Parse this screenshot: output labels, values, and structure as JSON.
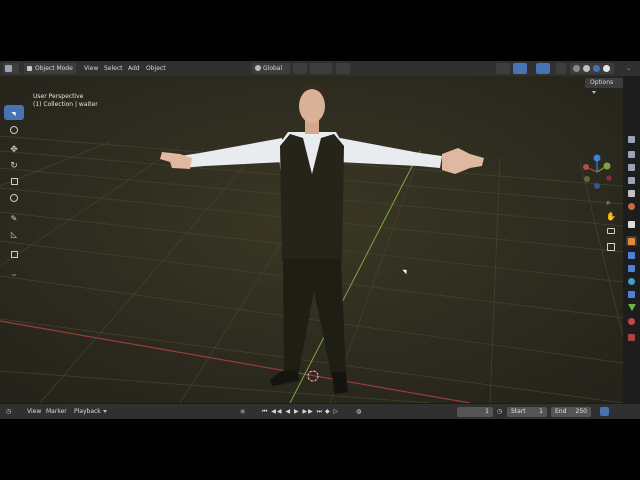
{
  "header": {
    "mode": "Object Mode",
    "menus": [
      "View",
      "Select",
      "Add",
      "Object"
    ],
    "orientation": "Global",
    "options_label": "Options"
  },
  "viewport": {
    "perspective_label": "User Perspective",
    "collection_label": "(1) Collection | waiter"
  },
  "timeline": {
    "menus": [
      "View",
      "Marker",
      "Playback"
    ],
    "current_frame": "1",
    "start_label": "Start",
    "start_value": "1",
    "end_label": "End",
    "end_value": "250"
  },
  "icons": {
    "toolbar": [
      "select-box-icon",
      "cursor-icon",
      "move-icon",
      "rotate-icon",
      "scale-icon",
      "transform-icon",
      "annotate-icon",
      "measure-icon",
      "add-cube-icon"
    ],
    "gizmo": [
      "zoom-icon",
      "pan-icon",
      "camera-view-icon",
      "grid-toggle-icon"
    ],
    "props": [
      "tool-icon",
      "render-icon",
      "output-icon",
      "view-layer-icon",
      "scene-icon",
      "world-icon",
      "collection-icon",
      "object-icon",
      "modifier-icon",
      "particles-icon",
      "physics-icon",
      "constraints-icon",
      "data-icon",
      "material-icon",
      "texture-icon"
    ]
  },
  "colors": {
    "accent": "#4772b3",
    "x_axis": "#9b3b3b",
    "y_axis": "#7fa344",
    "z_axis": "#3e7fd9",
    "grid": "#3c3a2a"
  }
}
